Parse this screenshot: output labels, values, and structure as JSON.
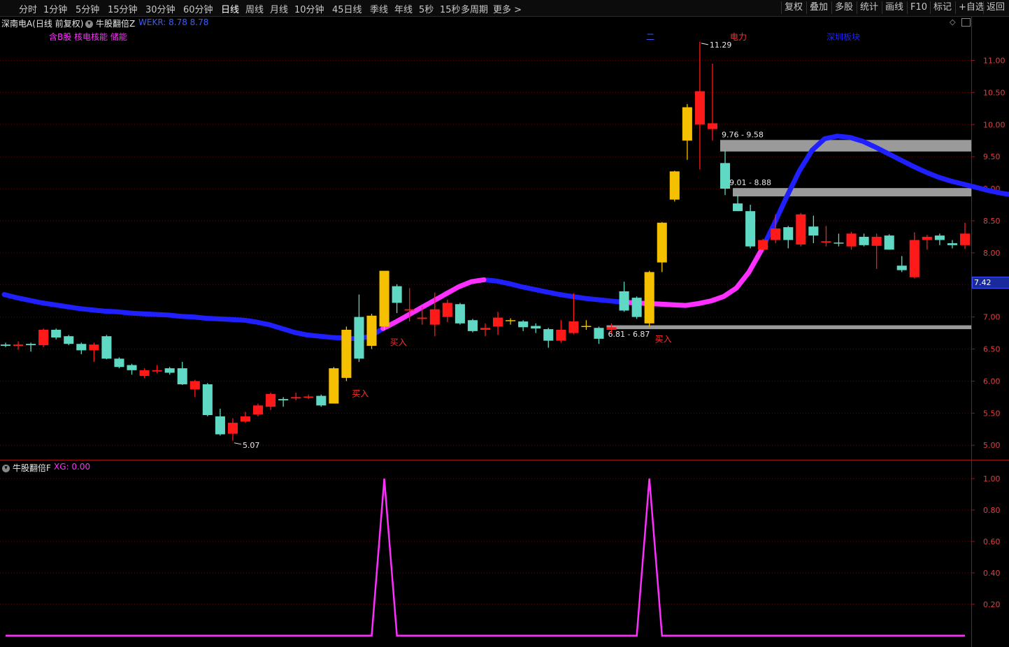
{
  "toolbar": {
    "periods": [
      "分时",
      "1分钟",
      "5分钟",
      "15分钟",
      "30分钟",
      "60分钟",
      "日线",
      "周线",
      "月线",
      "10分钟",
      "45日线",
      "季线",
      "年线",
      "5秒",
      "15秒",
      "多周期",
      "更多 >"
    ],
    "active_period": "日线",
    "right_buttons": [
      "复权",
      "叠加",
      "多股",
      "统计",
      "画线",
      "F10",
      "标记",
      "+自选",
      "返回"
    ]
  },
  "main_header": {
    "stock_title": "深南电A(日线 前复权)",
    "indicator_name": "牛股翻倍Z",
    "indicator_values": "WEKR: 8.78   8.78",
    "concept_tags": "含B股 核电核能 储能"
  },
  "chart_annotations": {
    "high_label": "11.29",
    "low_label": "5.07",
    "sector_label": "电力",
    "board_label": "深圳板块",
    "misc_label": "二",
    "current_price_badge": "7.42",
    "buy_label": "买入",
    "zones": [
      {
        "label": "9.76 - 9.58",
        "low": 9.58,
        "high": 9.76
      },
      {
        "label": "9.01 - 8.88",
        "low": 8.88,
        "high": 9.01
      },
      {
        "label": "6.81 - 6.87",
        "low": 6.81,
        "high": 6.87
      }
    ]
  },
  "indicator_header": {
    "name": "牛股翻倍F",
    "value_text": "XG: 0.00"
  },
  "chart_data": [
    {
      "type": "candlestick",
      "ylim": [
        4.85,
        11.55
      ],
      "yticks": [
        5.0,
        5.5,
        6.0,
        6.5,
        7.0,
        7.5,
        8.0,
        8.5,
        9.0,
        9.5,
        10.0,
        10.5,
        11.0
      ],
      "colors": {
        "up": "#ff1a1a",
        "down": "#5fd8c4",
        "highlight": "#f5c000",
        "ma_normal": "#2020ff",
        "ma_rising": "#ff30ff",
        "zone": "#9a9a9a"
      },
      "candles": [
        {
          "o": 6.55,
          "c": 6.57,
          "h": 6.6,
          "l": 6.53,
          "k": "d"
        },
        {
          "o": 6.55,
          "c": 6.57,
          "h": 6.62,
          "l": 6.49,
          "k": "u"
        },
        {
          "o": 6.58,
          "c": 6.56,
          "h": 6.6,
          "l": 6.46,
          "k": "d"
        },
        {
          "o": 6.56,
          "c": 6.8,
          "h": 6.82,
          "l": 6.53,
          "k": "u"
        },
        {
          "o": 6.8,
          "c": 6.68,
          "h": 6.82,
          "l": 6.65,
          "k": "d"
        },
        {
          "o": 6.7,
          "c": 6.58,
          "h": 6.72,
          "l": 6.56,
          "k": "d"
        },
        {
          "o": 6.58,
          "c": 6.48,
          "h": 6.6,
          "l": 6.42,
          "k": "d"
        },
        {
          "o": 6.48,
          "c": 6.57,
          "h": 6.6,
          "l": 6.3,
          "k": "u"
        },
        {
          "o": 6.7,
          "c": 6.35,
          "h": 6.72,
          "l": 6.34,
          "k": "d"
        },
        {
          "o": 6.35,
          "c": 6.22,
          "h": 6.37,
          "l": 6.2,
          "k": "d"
        },
        {
          "o": 6.25,
          "c": 6.17,
          "h": 6.27,
          "l": 6.1,
          "k": "d"
        },
        {
          "o": 6.08,
          "c": 6.17,
          "h": 6.2,
          "l": 6.05,
          "k": "u"
        },
        {
          "o": 6.15,
          "c": 6.17,
          "h": 6.25,
          "l": 6.12,
          "k": "u"
        },
        {
          "o": 6.2,
          "c": 6.13,
          "h": 6.22,
          "l": 6.1,
          "k": "d"
        },
        {
          "o": 6.2,
          "c": 5.95,
          "h": 6.3,
          "l": 5.94,
          "k": "d"
        },
        {
          "o": 5.87,
          "c": 6.0,
          "h": 6.02,
          "l": 5.75,
          "k": "u"
        },
        {
          "o": 5.95,
          "c": 5.47,
          "h": 5.97,
          "l": 5.45,
          "k": "d"
        },
        {
          "o": 5.45,
          "c": 5.17,
          "h": 5.57,
          "l": 5.15,
          "k": "d"
        },
        {
          "o": 5.18,
          "c": 5.35,
          "h": 5.42,
          "l": 5.07,
          "k": "u"
        },
        {
          "o": 5.37,
          "c": 5.45,
          "h": 5.52,
          "l": 5.35,
          "k": "u"
        },
        {
          "o": 5.48,
          "c": 5.62,
          "h": 5.65,
          "l": 5.45,
          "k": "u"
        },
        {
          "o": 5.6,
          "c": 5.8,
          "h": 5.82,
          "l": 5.55,
          "k": "u"
        },
        {
          "o": 5.7,
          "c": 5.72,
          "h": 5.75,
          "l": 5.6,
          "k": "d"
        },
        {
          "o": 5.73,
          "c": 5.75,
          "h": 5.82,
          "l": 5.7,
          "k": "u"
        },
        {
          "o": 5.74,
          "c": 5.76,
          "h": 5.79,
          "l": 5.72,
          "k": "u"
        },
        {
          "o": 5.77,
          "c": 5.62,
          "h": 5.79,
          "l": 5.6,
          "k": "d"
        },
        {
          "o": 5.65,
          "c": 6.2,
          "h": 6.22,
          "l": 5.65,
          "k": "y"
        },
        {
          "o": 6.05,
          "c": 6.8,
          "h": 6.85,
          "l": 6.0,
          "k": "y"
        },
        {
          "o": 6.35,
          "c": 7.0,
          "h": 7.35,
          "l": 6.3,
          "k": "d"
        },
        {
          "o": 6.55,
          "c": 7.02,
          "h": 7.05,
          "l": 6.5,
          "k": "y"
        },
        {
          "o": 6.85,
          "c": 7.72,
          "h": 7.72,
          "l": 6.8,
          "k": "y"
        },
        {
          "o": 7.48,
          "c": 7.22,
          "h": 7.51,
          "l": 7.06,
          "k": "d"
        },
        {
          "o": 7.1,
          "c": 7.12,
          "h": 7.45,
          "l": 6.93,
          "k": "u"
        },
        {
          "o": 6.97,
          "c": 6.99,
          "h": 7.16,
          "l": 6.88,
          "k": "u"
        },
        {
          "o": 6.88,
          "c": 7.12,
          "h": 7.38,
          "l": 6.7,
          "k": "u"
        },
        {
          "o": 7.0,
          "c": 7.22,
          "h": 7.27,
          "l": 6.92,
          "k": "u"
        },
        {
          "o": 7.2,
          "c": 6.9,
          "h": 7.22,
          "l": 6.88,
          "k": "d"
        },
        {
          "o": 6.95,
          "c": 6.78,
          "h": 6.97,
          "l": 6.76,
          "k": "d"
        },
        {
          "o": 6.8,
          "c": 6.83,
          "h": 6.9,
          "l": 6.7,
          "k": "u"
        },
        {
          "o": 6.85,
          "c": 6.99,
          "h": 7.08,
          "l": 6.72,
          "k": "u"
        },
        {
          "o": 6.95,
          "c": 6.94,
          "h": 6.98,
          "l": 6.88,
          "k": "y"
        },
        {
          "o": 6.93,
          "c": 6.84,
          "h": 6.95,
          "l": 6.78,
          "k": "d"
        },
        {
          "o": 6.86,
          "c": 6.82,
          "h": 6.9,
          "l": 6.75,
          "k": "d"
        },
        {
          "o": 6.81,
          "c": 6.63,
          "h": 6.83,
          "l": 6.52,
          "k": "d"
        },
        {
          "o": 6.63,
          "c": 6.8,
          "h": 6.95,
          "l": 6.6,
          "k": "u"
        },
        {
          "o": 6.75,
          "c": 6.93,
          "h": 7.37,
          "l": 6.73,
          "k": "u"
        },
        {
          "o": 6.85,
          "c": 6.86,
          "h": 6.95,
          "l": 6.8,
          "k": "y"
        },
        {
          "o": 6.83,
          "c": 6.66,
          "h": 6.85,
          "l": 6.58,
          "k": "d"
        },
        {
          "o": 6.8,
          "c": 6.84,
          "h": 6.9,
          "l": 6.75,
          "k": "u"
        },
        {
          "o": 7.4,
          "c": 7.1,
          "h": 7.55,
          "l": 7.08,
          "k": "d"
        },
        {
          "o": 7.3,
          "c": 7.0,
          "h": 7.32,
          "l": 6.97,
          "k": "d"
        },
        {
          "o": 6.9,
          "c": 7.7,
          "h": 7.72,
          "l": 6.85,
          "k": "y"
        },
        {
          "o": 7.85,
          "c": 8.47,
          "h": 8.48,
          "l": 7.7,
          "k": "y"
        },
        {
          "o": 8.83,
          "c": 9.27,
          "h": 9.28,
          "l": 8.8,
          "k": "y"
        },
        {
          "o": 9.75,
          "c": 10.27,
          "h": 10.32,
          "l": 9.45,
          "k": "y"
        },
        {
          "o": 10.0,
          "c": 10.52,
          "h": 11.29,
          "l": 9.3,
          "k": "u"
        },
        {
          "o": 10.02,
          "c": 9.93,
          "h": 10.95,
          "l": 9.75,
          "k": "u"
        },
        {
          "o": 9.4,
          "c": 9.0,
          "h": 9.6,
          "l": 8.9,
          "k": "d"
        },
        {
          "o": 8.77,
          "c": 8.65,
          "h": 8.9,
          "l": 8.65,
          "k": "d"
        },
        {
          "o": 8.65,
          "c": 8.1,
          "h": 8.75,
          "l": 8.07,
          "k": "d"
        },
        {
          "o": 8.05,
          "c": 8.2,
          "h": 8.22,
          "l": 8.04,
          "k": "u"
        },
        {
          "o": 8.2,
          "c": 8.38,
          "h": 8.6,
          "l": 8.15,
          "k": "u"
        },
        {
          "o": 8.4,
          "c": 8.2,
          "h": 8.42,
          "l": 8.07,
          "k": "d"
        },
        {
          "o": 8.13,
          "c": 8.6,
          "h": 8.62,
          "l": 8.1,
          "k": "u"
        },
        {
          "o": 8.41,
          "c": 8.27,
          "h": 8.58,
          "l": 8.15,
          "k": "d"
        },
        {
          "o": 8.16,
          "c": 8.18,
          "h": 8.42,
          "l": 8.1,
          "k": "u"
        },
        {
          "o": 8.15,
          "c": 8.16,
          "h": 8.3,
          "l": 8.1,
          "k": "d"
        },
        {
          "o": 8.1,
          "c": 8.3,
          "h": 8.33,
          "l": 8.05,
          "k": "u"
        },
        {
          "o": 8.25,
          "c": 8.12,
          "h": 8.3,
          "l": 8.1,
          "k": "d"
        },
        {
          "o": 8.11,
          "c": 8.25,
          "h": 8.3,
          "l": 7.75,
          "k": "u"
        },
        {
          "o": 8.27,
          "c": 8.05,
          "h": 8.29,
          "l": 8.05,
          "k": "d"
        },
        {
          "o": 7.8,
          "c": 7.73,
          "h": 7.95,
          "l": 7.7,
          "k": "d"
        },
        {
          "o": 7.62,
          "c": 8.2,
          "h": 8.32,
          "l": 7.6,
          "k": "u"
        },
        {
          "o": 8.25,
          "c": 8.2,
          "h": 8.28,
          "l": 8.05,
          "k": "u"
        },
        {
          "o": 8.27,
          "c": 8.2,
          "h": 8.3,
          "l": 8.12,
          "k": "d"
        },
        {
          "o": 8.12,
          "c": 8.15,
          "h": 8.2,
          "l": 8.07,
          "k": "d"
        },
        {
          "o": 8.12,
          "c": 8.3,
          "h": 8.47,
          "l": 8.06,
          "k": "u"
        }
      ],
      "ma_line": [
        7.35,
        7.3,
        7.26,
        7.22,
        7.19,
        7.16,
        7.13,
        7.11,
        7.09,
        7.08,
        7.06,
        7.05,
        7.04,
        7.03,
        7.01,
        7.0,
        6.98,
        6.97,
        6.96,
        6.95,
        6.92,
        6.88,
        6.82,
        6.76,
        6.72,
        6.7,
        6.68,
        6.67,
        6.66,
        6.7,
        6.82,
        6.92,
        7.03,
        7.14,
        7.25,
        7.36,
        7.47,
        7.55,
        7.58,
        7.56,
        7.52,
        7.47,
        7.43,
        7.39,
        7.35,
        7.32,
        7.29,
        7.27,
        7.25,
        7.23,
        7.22,
        7.21,
        7.2,
        7.19,
        7.18,
        7.21,
        7.25,
        7.32,
        7.45,
        7.7,
        8.05,
        8.45,
        8.88,
        9.28,
        9.6,
        9.78,
        9.82,
        9.8,
        9.74,
        9.65,
        9.55,
        9.45,
        9.35,
        9.26,
        9.18,
        9.12,
        9.07,
        9.02,
        8.97,
        8.93,
        8.9,
        8.87,
        8.84,
        8.81,
        8.79,
        8.78,
        8.78
      ],
      "buy_signals_at_candle": [
        27,
        30,
        51
      ],
      "ma_rising_segments": [
        [
          30,
          38
        ],
        [
          49,
          60
        ]
      ]
    },
    {
      "type": "line",
      "name": "XG",
      "ylim": [
        -0.05,
        1.08
      ],
      "yticks": [
        0.2,
        0.4,
        0.6,
        0.8,
        1.0
      ],
      "color": "#ff30ff",
      "spikes_at_candle": [
        30,
        51
      ],
      "spike_value": 1.0
    }
  ]
}
